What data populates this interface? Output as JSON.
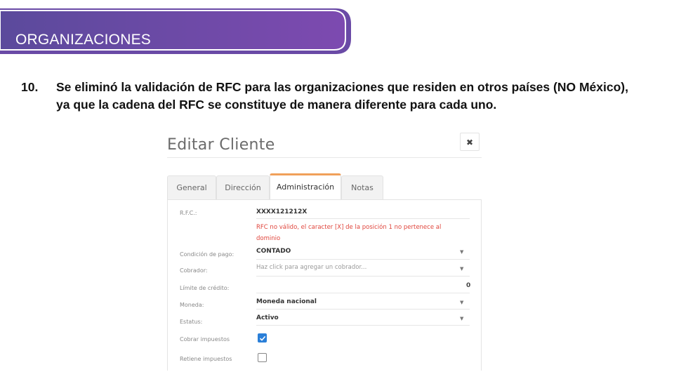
{
  "header": {
    "title": "ORGANIZACIONES",
    "gradient_start": "#5b4a9c",
    "gradient_end": "#7d4ab0"
  },
  "note": {
    "number": "10.",
    "text": "Se eliminó la validación de RFC para las organizaciones que residen en otros países (NO México), ya que la cadena del RFC se constituye de manera diferente para cada uno."
  },
  "dialog": {
    "title": "Editar Cliente",
    "close_icon": "close-icon",
    "tabs": [
      {
        "label": "General",
        "active": false
      },
      {
        "label": "Dirección",
        "active": false
      },
      {
        "label": "Administración",
        "active": true
      },
      {
        "label": "Notas",
        "active": false
      }
    ],
    "fields": {
      "rfc": {
        "label": "R.F.C.:",
        "value": "XXXX121212X",
        "error": "RFC no válido, el caracter [X] de la posición 1 no pertenece al dominio"
      },
      "condicion": {
        "label": "Condición de pago:",
        "value": "CONTADO"
      },
      "cobrador": {
        "label": "Cobrador:",
        "placeholder": "Haz click para agregar un cobrador..."
      },
      "limite": {
        "label": "Límite de crédito:",
        "value": "0"
      },
      "moneda": {
        "label": "Moneda:",
        "value": "Moneda nacional"
      },
      "estatus": {
        "label": "Estatus:",
        "value": "Activo"
      },
      "cobrar": {
        "label": "Cobrar impuestos",
        "checked": true
      },
      "retiene": {
        "label": "Retiene impuestos",
        "checked": false
      }
    },
    "accent_color": "#f0a05a",
    "error_color": "#e0453c",
    "checkbox_color": "#2a7fd8"
  }
}
